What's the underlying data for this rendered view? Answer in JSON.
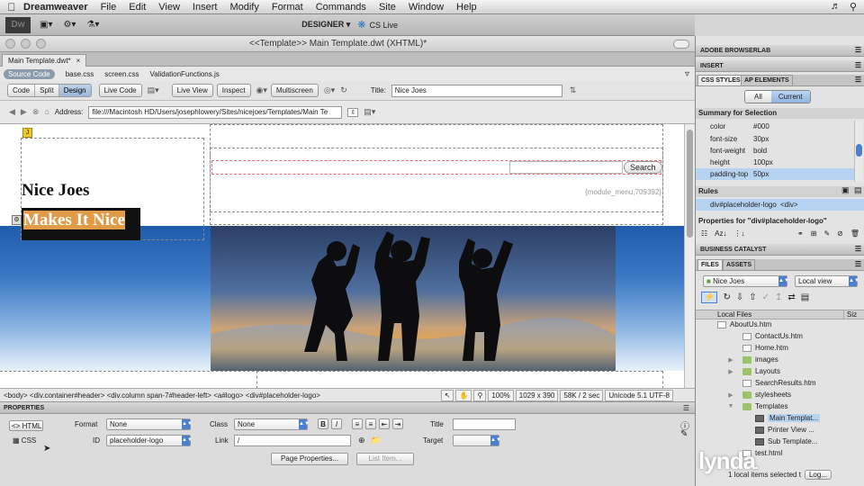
{
  "menubar": {
    "app": "Dreamweaver",
    "items": [
      "File",
      "Edit",
      "View",
      "Insert",
      "Modify",
      "Format",
      "Commands",
      "Site",
      "Window",
      "Help"
    ]
  },
  "appbar": {
    "logo": "Dw",
    "workspace": "DESIGNER",
    "cslive": "CS Live"
  },
  "window": {
    "title": "<<Template>> Main Template.dwt (XHTML)*"
  },
  "doc_tab": {
    "label": "Main Template.dwt*"
  },
  "related_files": {
    "source": "Source Code",
    "files": [
      "base.css",
      "screen.css",
      "ValidationFunctions.js"
    ]
  },
  "doc_toolbar": {
    "views": [
      "Code",
      "Split",
      "Design"
    ],
    "active_view": "Design",
    "live_code": "Live Code",
    "live_view": "Live View",
    "inspect": "Inspect",
    "multiscreen": "Multiscreen",
    "title_label": "Title:",
    "title_value": "Nice Joes"
  },
  "address": {
    "label": "Address:",
    "value": "file:///Macintosh HD/Users/josephlowery/Sites/nicejoes/Templates/Main Te"
  },
  "canvas": {
    "site_name": "Nice Joes",
    "tagline": "Makes It Nice",
    "search_button": "Search",
    "module_menu": "{module_menu,709392}"
  },
  "tag_selector": {
    "path": "<body> <div.container#header> <div.column span-7#header-left> <a#logo> <div#placeholder-logo>",
    "zoom": "100%",
    "size": "1029 x 390",
    "download": "58K / 2 sec",
    "encoding": "Unicode 5.1 UTF-8"
  },
  "properties": {
    "header": "PROPERTIES",
    "html_btn": "HTML",
    "css_btn": "CSS",
    "format_label": "Format",
    "format_value": "None",
    "class_label": "Class",
    "class_value": "None",
    "id_label": "ID",
    "id_value": "placeholder-logo",
    "link_label": "Link",
    "link_value": "/",
    "title_label": "Title",
    "title_value": "",
    "target_label": "Target",
    "target_value": "",
    "page_props": "Page Properties...",
    "list_item": "List Item..."
  },
  "panels": {
    "browserlab": "ADOBE BROWSERLAB",
    "insert": "INSERT",
    "css_styles_tab": "CSS STYLES",
    "ap_elements_tab": "AP ELEMENTS",
    "all_btn": "All",
    "current_btn": "Current",
    "summary_label": "Summary for Selection",
    "summary": [
      {
        "k": "color",
        "v": "#000"
      },
      {
        "k": "font-size",
        "v": "30px"
      },
      {
        "k": "font-weight",
        "v": "bold"
      },
      {
        "k": "height",
        "v": "100px"
      },
      {
        "k": "padding-top",
        "v": "50px"
      }
    ],
    "rules_label": "Rules",
    "rule_selector": "div#placeholder-logo",
    "rule_tag": "<div>",
    "properties_for": "Properties for \"div#placeholder-logo\"",
    "business_catalyst": "BUSINESS CATALYST",
    "files_tab": "FILES",
    "assets_tab": "ASSETS",
    "site_select": "Nice Joes",
    "view_select": "Local view",
    "local_files": "Local Files",
    "size_col": "Siz",
    "files": [
      {
        "name": "AboutUs.htm",
        "type": "doc",
        "indent": 1
      },
      {
        "name": "ContactUs.htm",
        "type": "doc",
        "indent": 1
      },
      {
        "name": "Home.htm",
        "type": "doc",
        "indent": 1
      },
      {
        "name": "images",
        "type": "folder",
        "indent": 1
      },
      {
        "name": "Layouts",
        "type": "folder",
        "indent": 1
      },
      {
        "name": "SearchResults.htm",
        "type": "doc",
        "indent": 1
      },
      {
        "name": "stylesheets",
        "type": "folder",
        "indent": 1
      },
      {
        "name": "Templates",
        "type": "folder",
        "indent": 1
      },
      {
        "name": "Main Templat...",
        "type": "tpl",
        "indent": 2
      },
      {
        "name": "Printer View ...",
        "type": "tpl",
        "indent": 2
      },
      {
        "name": "Sub Template...",
        "type": "tpl",
        "indent": 2
      },
      {
        "name": "test.html",
        "type": "doc",
        "indent": 1
      }
    ],
    "status": "1 local items selected t",
    "log_btn": "Log..."
  },
  "watermark": "lynda"
}
